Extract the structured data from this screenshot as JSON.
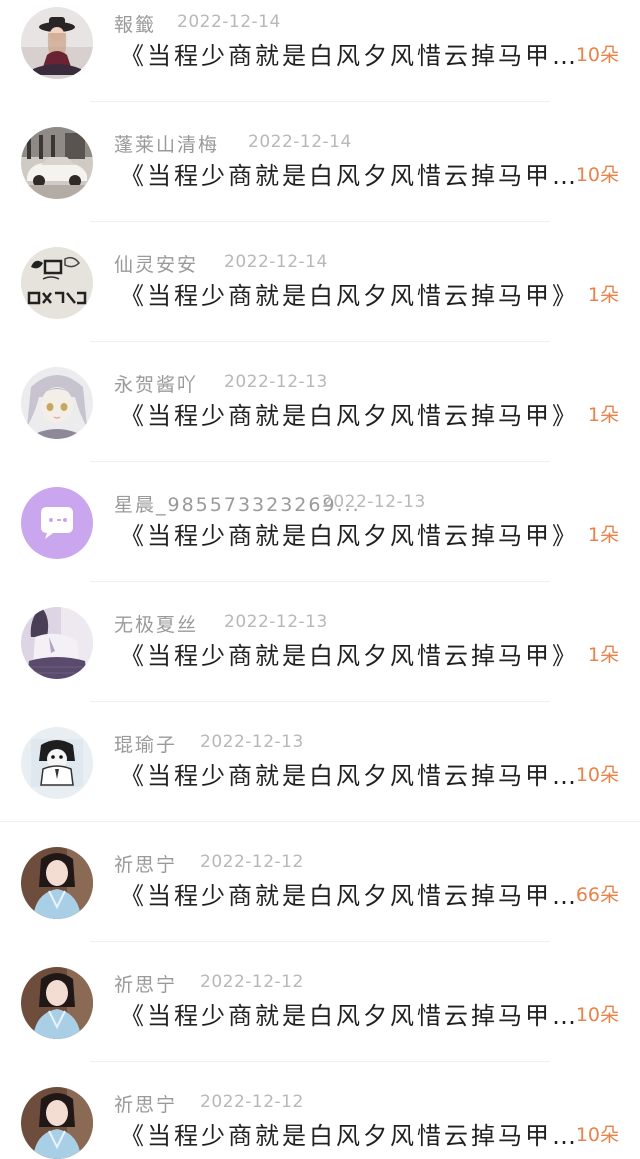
{
  "rows": [
    {
      "name": "報籤",
      "date": "2022-12-14",
      "book": "《当程少商就是白风夕风惜云掉马甲…",
      "count": "10朵",
      "avatar": "girl-hat-avatar"
    },
    {
      "name": "蓬莱山清梅",
      "date": "2022-12-14",
      "book": "《当程少商就是白风夕风惜云掉马甲…",
      "count": "10朵",
      "avatar": "car-avatar"
    },
    {
      "name": "仙灵安安",
      "date": "2022-12-14",
      "book": "《当程少商就是白风夕风惜云掉马甲》",
      "count": "1朵",
      "avatar": "goodbye-text-avatar"
    },
    {
      "name": "永贺酱吖",
      "date": "2022-12-13",
      "book": "《当程少商就是白风夕风惜云掉马甲》",
      "count": "1朵",
      "avatar": "anime-girl-avatar"
    },
    {
      "name": "星晨_985573323269...",
      "date": "2022-12-13",
      "book": "《当程少商就是白风夕风惜云掉马甲》",
      "count": "1朵",
      "avatar": "default-chat-avatar"
    },
    {
      "name": "无极夏丝",
      "date": "2022-12-13",
      "book": "《当程少商就是白风夕风惜云掉马甲》",
      "count": "1朵",
      "avatar": "uniform-girl-avatar"
    },
    {
      "name": "琨瑜子",
      "date": "2022-12-13",
      "book": "《当程少商就是白风夕风惜云掉马甲…",
      "count": "10朵",
      "avatar": "bw-character-avatar"
    },
    {
      "name": "祈思宁",
      "date": "2022-12-12",
      "book": "《当程少商就是白风夕风惜云掉马甲…",
      "count": "66朵",
      "avatar": "hanfu-girl-avatar"
    },
    {
      "name": "祈思宁",
      "date": "2022-12-12",
      "book": "《当程少商就是白风夕风惜云掉马甲…",
      "count": "10朵",
      "avatar": "hanfu-girl-avatar"
    },
    {
      "name": "祈思宁",
      "date": "2022-12-12",
      "book": "《当程少商就是白风夕风惜云掉马甲…",
      "count": "10朵",
      "avatar": "hanfu-girl-avatar"
    }
  ],
  "colors": {
    "name": "#9a9a9a",
    "date": "#b8b8b8",
    "book": "#222222",
    "count": "#e8834a",
    "default_avatar_bg": "#c9a6ee"
  }
}
